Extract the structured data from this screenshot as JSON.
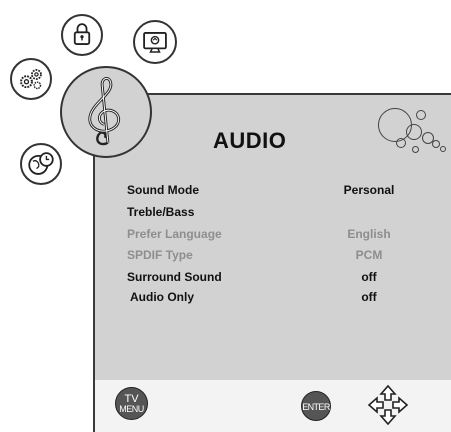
{
  "page": {
    "title": "AUDIO"
  },
  "nav": {
    "lock_icon": "lock-icon",
    "settings_icon": "gear-icon",
    "audio_icon": "treble-clef-icon",
    "display_icon": "monitor-icon",
    "time_icon": "globe-clock-icon"
  },
  "menu": {
    "items": [
      {
        "label": "Sound Mode",
        "value": "Personal",
        "enabled": true
      },
      {
        "label": "Treble/Bass",
        "value": "",
        "enabled": true
      },
      {
        "label": "Prefer Language",
        "value": "English",
        "enabled": false
      },
      {
        "label": "SPDIF Type",
        "value": "PCM",
        "enabled": false
      },
      {
        "label": "Surround Sound",
        "value": "off",
        "enabled": true
      },
      {
        "label": "Audio Only",
        "value": "off",
        "enabled": true
      }
    ]
  },
  "footer": {
    "menu_key_line1": "TV",
    "menu_key_line2": "MENU",
    "enter_key": "ENTER"
  },
  "colors": {
    "panel": "#d2d2d2",
    "disabled_text": "#8e8e8e"
  }
}
